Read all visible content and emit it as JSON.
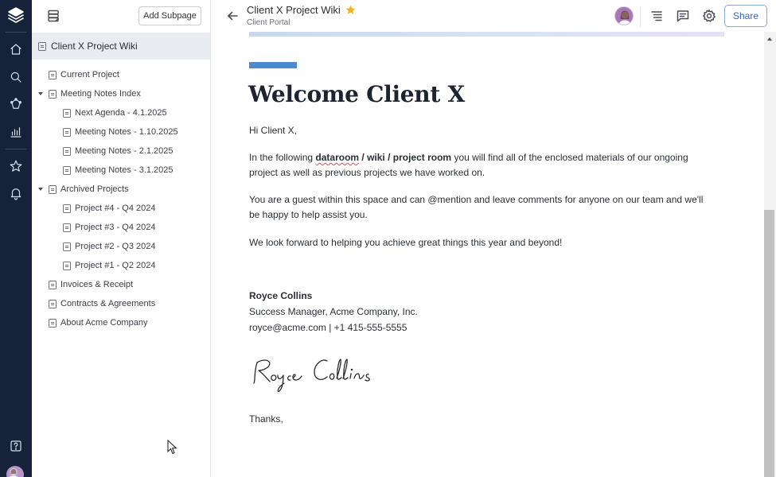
{
  "rail": {
    "icons": [
      "logo-icon",
      "home-icon",
      "search-icon",
      "spaces-icon",
      "analytics-icon",
      "star-icon",
      "bell-icon",
      "help-icon"
    ]
  },
  "sidebar": {
    "add_subpage_label": "Add Subpage",
    "root": "Client X Project Wiki",
    "items": [
      {
        "label": "Current Project"
      },
      {
        "label": "Meeting Notes Index",
        "expanded": true
      },
      {
        "label": "Next Agenda - 4.1.2025"
      },
      {
        "label": "Meeting Notes - 1.10.2025"
      },
      {
        "label": "Meeting Notes - 2.1.2025"
      },
      {
        "label": "Meeting Notes - 3.1.2025"
      },
      {
        "label": "Archived Projects",
        "expanded": true
      },
      {
        "label": "Project #4 - Q4 2024"
      },
      {
        "label": "Project #3 - Q4 2024"
      },
      {
        "label": "Project #2 - Q3 2024"
      },
      {
        "label": "Project #1 - Q2 2024"
      },
      {
        "label": "Invoices & Receipt"
      },
      {
        "label": "Contracts & Agreements"
      },
      {
        "label": "About Acme Company"
      }
    ]
  },
  "header": {
    "title": "Client X Project Wiki",
    "subtitle": "Client Portal",
    "share_label": "Share",
    "starred": true
  },
  "content": {
    "heading": "Welcome Client X",
    "greeting": "Hi Client X,",
    "para1": {
      "pre": "In the following ",
      "bold_a": "dataroom",
      "bold_b": " / wiki / project room",
      "post": " you will find all of the enclosed materials of our ongoing",
      "line2": "project as well as previous projects we have worked on."
    },
    "para2": {
      "line1": "You are a guest within this space and can @mention and leave comments for anyone on our team and we'll",
      "line2": "be happy to help assist you."
    },
    "para3": "We look forward to helping you achieve great things this year and beyond!",
    "signoff": {
      "name": "Royce Collins",
      "role": "Success Manager, Acme Company, Inc.",
      "contact": "royce@acme.com | +1 415-555-5555",
      "signature": "Royce Collins"
    },
    "thanks": "Thanks,"
  },
  "colors": {
    "rail_bg": "#15223a",
    "accent": "#4c8ac9",
    "star": "#f2b51b",
    "share": "#2f66c0"
  }
}
